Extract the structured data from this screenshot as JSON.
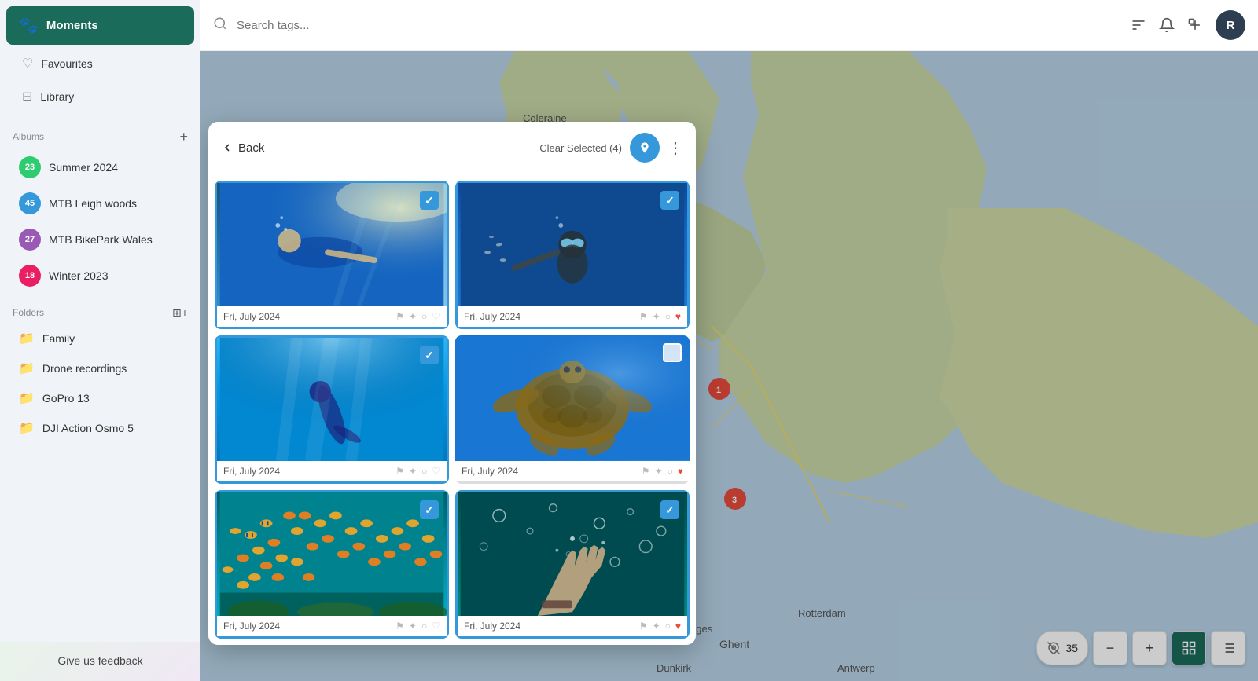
{
  "sidebar": {
    "moments_label": "Moments",
    "favourites_label": "Favourites",
    "library_label": "Library",
    "albums_section": "Albums",
    "folders_section": "Folders",
    "albums": [
      {
        "id": 1,
        "label": "Summer 2024",
        "count": "23",
        "color": "green"
      },
      {
        "id": 2,
        "label": "MTB Leigh woods",
        "count": "45",
        "color": "blue"
      },
      {
        "id": 3,
        "label": "MTB BikePark Wales",
        "count": "27",
        "color": "purple"
      },
      {
        "id": 4,
        "label": "Winter 2023",
        "count": "18",
        "color": "pink"
      }
    ],
    "folders": [
      {
        "id": 1,
        "label": "Family"
      },
      {
        "id": 2,
        "label": "Drone recordings"
      },
      {
        "id": 3,
        "label": "GoPro 13"
      },
      {
        "id": 4,
        "label": "DJI Action Osmo 5"
      }
    ],
    "feedback_label": "Give us feedback"
  },
  "topbar": {
    "search_placeholder": "Search tags...",
    "avatar_initials": "R"
  },
  "modal": {
    "back_label": "Back",
    "clear_selected_label": "Clear Selected (4)",
    "photos": [
      {
        "id": 1,
        "date": "Fri, July 2024",
        "selected": true,
        "liked": false
      },
      {
        "id": 2,
        "date": "Fri, July 2024",
        "selected": true,
        "liked": true
      },
      {
        "id": 3,
        "date": "Fri, July 2024",
        "selected": true,
        "liked": false
      },
      {
        "id": 4,
        "date": "Fri, July 2024",
        "selected": false,
        "liked": true
      },
      {
        "id": 5,
        "date": "Fri, July 2024",
        "selected": true,
        "liked": false
      },
      {
        "id": 6,
        "date": "Fri, July 2024",
        "selected": true,
        "liked": true
      }
    ]
  },
  "map_controls": {
    "count": "35",
    "zoom_in": "+",
    "zoom_out": "−"
  }
}
